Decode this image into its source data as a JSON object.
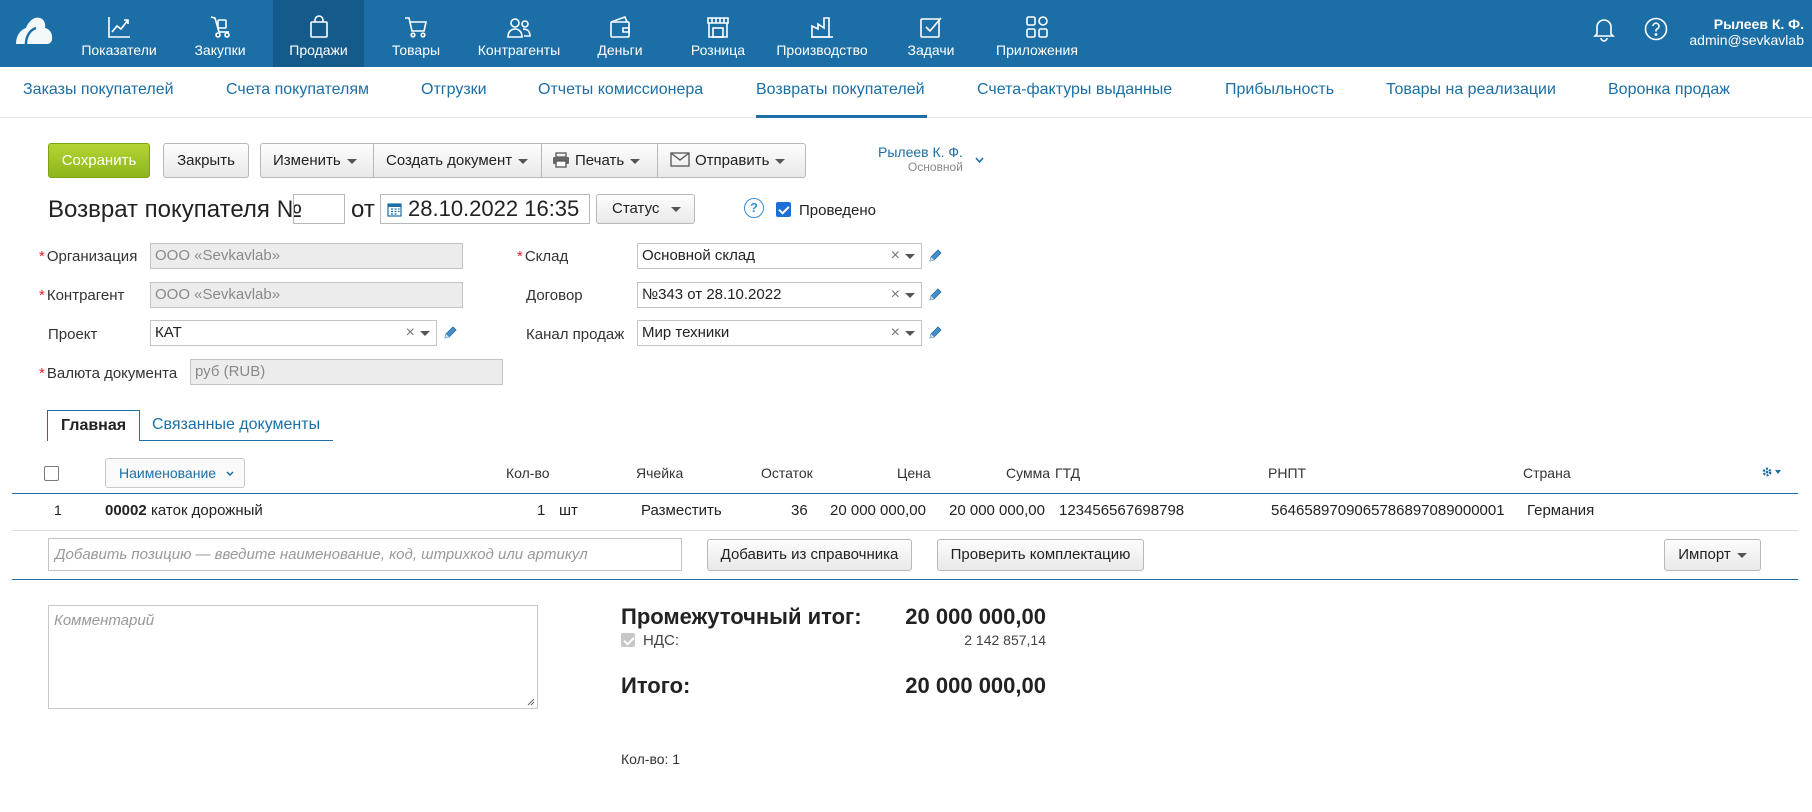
{
  "topnav": {
    "items": [
      {
        "label": "Показатели",
        "icon": "chart-line-icon"
      },
      {
        "label": "Закупки",
        "icon": "cart-hand-icon"
      },
      {
        "label": "Продажи",
        "icon": "shopping-bag-icon",
        "active": true
      },
      {
        "label": "Товары",
        "icon": "shopping-cart-icon"
      },
      {
        "label": "Контрагенты",
        "icon": "people-icon"
      },
      {
        "label": "Деньги",
        "icon": "wallet-icon"
      },
      {
        "label": "Розница",
        "icon": "store-icon"
      },
      {
        "label": "Производство",
        "icon": "factory-icon"
      },
      {
        "label": "Задачи",
        "icon": "checkbox-icon"
      },
      {
        "label": "Приложения",
        "icon": "apps-icon"
      }
    ],
    "user_name": "Рылеев К. Ф.",
    "user_email": "admin@sevkavlab",
    "brand_color": "#1b6fa6"
  },
  "subnav": {
    "items": [
      "Заказы покупателей",
      "Счета покупателям",
      "Отгрузки",
      "Отчеты комиссионера",
      "Возвраты покупателей",
      "Счета-фактуры выданные",
      "Прибыльность",
      "Товары на реализации",
      "Воронка продаж"
    ],
    "active": "Возвраты покупателей"
  },
  "toolbar": {
    "save": "Сохранить",
    "close": "Закрыть",
    "change": "Изменить",
    "create_doc": "Создать документ",
    "print": "Печать",
    "send": "Отправить",
    "owner_name": "Рылеев К. Ф.",
    "owner_role": "Основной"
  },
  "doc": {
    "title": "Возврат покупателя №",
    "number": "",
    "from": "от",
    "date": "28.10.2022 16:35",
    "status": "Статус",
    "help": "?",
    "posted_label": "Проведено",
    "posted": true
  },
  "form": {
    "org_label": "Организация",
    "org_value": "ООО «Sevkavlab»",
    "counterparty_label": "Контрагент",
    "counterparty_value": "ООО «Sevkavlab»",
    "project_label": "Проект",
    "project_value": "КАТ",
    "currency_label": "Валюта документа",
    "currency_value": "руб (RUB)",
    "warehouse_label": "Склад",
    "warehouse_value": "Основной склад",
    "contract_label": "Договор",
    "contract_value": "№343 от 28.10.2022",
    "channel_label": "Канал продаж",
    "channel_value": "Мир техники"
  },
  "tabs": {
    "main": "Главная",
    "related": "Связанные документы"
  },
  "table": {
    "headers": {
      "name": "Наименование",
      "qty": "Кол-во",
      "cell": "Ячейка",
      "stock": "Остаток",
      "price": "Цена",
      "sum": "Сумма",
      "gtd": "ГТД",
      "rnpt": "РНПТ",
      "country": "Страна"
    },
    "rows": [
      {
        "num": "1",
        "code": "00002",
        "name": "каток дорожный",
        "qty": "1",
        "unit": "шт",
        "cell": "Разместить",
        "stock": "36",
        "price": "20 000 000,00",
        "sum": "20 000 000,00",
        "gtd": "123456567698798",
        "rnpt": "5646589709065786897089000001",
        "country": "Германия"
      }
    ],
    "add_placeholder": "Добавить позицию — введите наименование, код, штрихкод или артикул",
    "add_from_catalog": "Добавить из справочника",
    "check_set": "Проверить комплектацию",
    "import": "Импорт"
  },
  "summary": {
    "comment_placeholder": "Комментарий",
    "subtotal_label": "Промежуточный итог:",
    "subtotal_value": "20 000 000,00",
    "vat_label": "НДС:",
    "vat_value": "2 142 857,14",
    "total_label": "Итого:",
    "total_value": "20 000 000,00",
    "qty_total": "Кол-во: 1"
  }
}
